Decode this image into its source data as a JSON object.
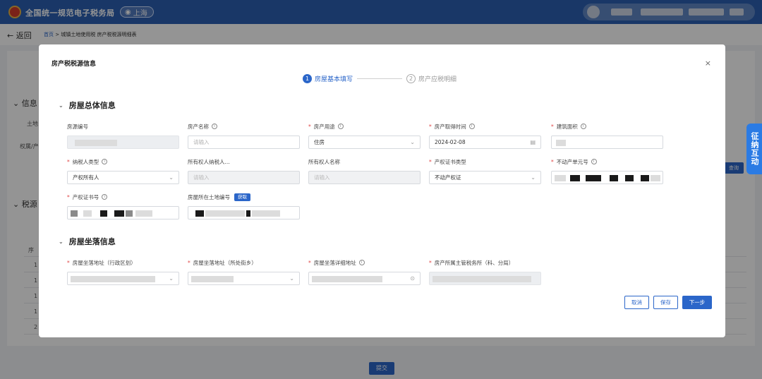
{
  "header": {
    "app_title": "全国统一规范电子税务局",
    "region": "上海"
  },
  "nav": {
    "back_label": "返回",
    "breadcrumb_home": "首页",
    "breadcrumb_current": "城镇土地使用税 房产税税源明细表"
  },
  "background": {
    "section1_title": "信息",
    "section2_title": "税源",
    "label_land": "土地",
    "label_owner": "权属/产",
    "query_label": "查询",
    "submit_label": "提交",
    "row_prefixes": [
      "序",
      "1",
      "1",
      "1",
      "1",
      "2"
    ],
    "side_tab": "征纳互动"
  },
  "modal": {
    "title": "房产税税源信息",
    "close_icon": "×",
    "steps": [
      {
        "num": "1",
        "label": "房屋基本填写",
        "state": "active"
      },
      {
        "num": "2",
        "label": "房产应税明细",
        "state": "todo"
      }
    ],
    "section_general": "房屋总体信息",
    "section_location": "房屋坐落信息",
    "fields": {
      "source_no": {
        "label": "房源编号",
        "value": ""
      },
      "property_name": {
        "label": "房产名称",
        "placeholder": "请输入"
      },
      "property_use": {
        "label": "房产用途",
        "value": "住房"
      },
      "acquire_time": {
        "label": "房产取得时间",
        "value": "2024-02-08"
      },
      "building_area": {
        "label": "建筑面积",
        "value": ""
      },
      "taxpayer_type": {
        "label": "纳税人类型",
        "value": "产权所有人"
      },
      "owner_taxid": {
        "label": "所有权人纳税人...",
        "placeholder": "请输入"
      },
      "owner_name": {
        "label": "所有权人名称",
        "placeholder": "请输入"
      },
      "cert_type": {
        "label": "产权证书类型",
        "value": "不动产权证"
      },
      "unit_no": {
        "label": "不动产单元号",
        "value": ""
      },
      "cert_no": {
        "label": "产权证书号",
        "value": ""
      },
      "land_no": {
        "label": "房屋所在土地编号",
        "value": "",
        "fetch_label": "获取"
      },
      "addr_district": {
        "label": "房屋坐落地址（行政区划）",
        "value": ""
      },
      "addr_street": {
        "label": "房屋坐落地址（所处街乡）",
        "value": ""
      },
      "addr_detail": {
        "label": "房屋坐落详细地址",
        "value": ""
      },
      "tax_office": {
        "label": "房产所属主管税务所（科、分局）",
        "value": ""
      }
    },
    "buttons": {
      "cancel": "取消",
      "save": "保存",
      "next": "下一步"
    }
  }
}
